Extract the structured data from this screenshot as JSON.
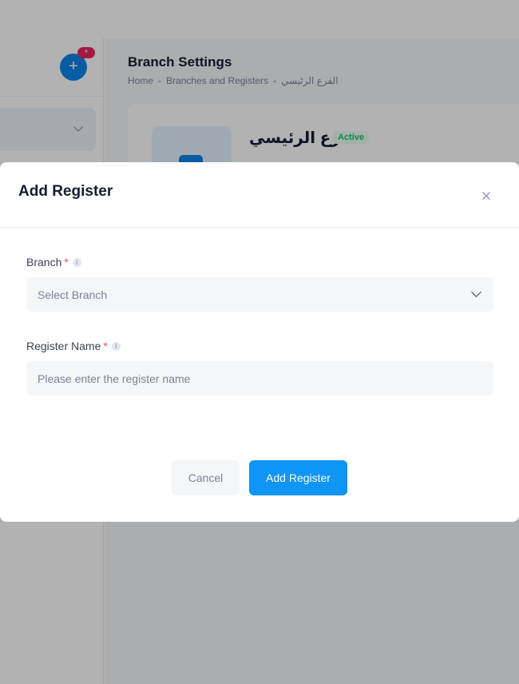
{
  "app": {
    "fab_icon": "plus-icon",
    "fab_badge": "*",
    "page_title": "Branch Settings",
    "breadcrumb": {
      "home": "Home",
      "separator": "-",
      "branches": "Branches and Registers",
      "current": "الفرع الرئيسي"
    },
    "branch_card": {
      "name": "الفرع الرئيسي",
      "status": "Active"
    }
  },
  "modal": {
    "title": "Add Register",
    "close_icon": "close-icon",
    "branch_field": {
      "label": "Branch",
      "required_mark": "*",
      "info_icon": "i",
      "placeholder": "Select Branch"
    },
    "register_name_field": {
      "label": "Register Name",
      "required_mark": "*",
      "info_icon": "i",
      "placeholder": "Please enter the register name",
      "value": ""
    },
    "buttons": {
      "cancel": "Cancel",
      "submit": "Add Register"
    }
  },
  "colors": {
    "primary": "#0e95f6",
    "danger": "#f1416c",
    "success": "#1ac275",
    "badge": "#e8285a"
  }
}
